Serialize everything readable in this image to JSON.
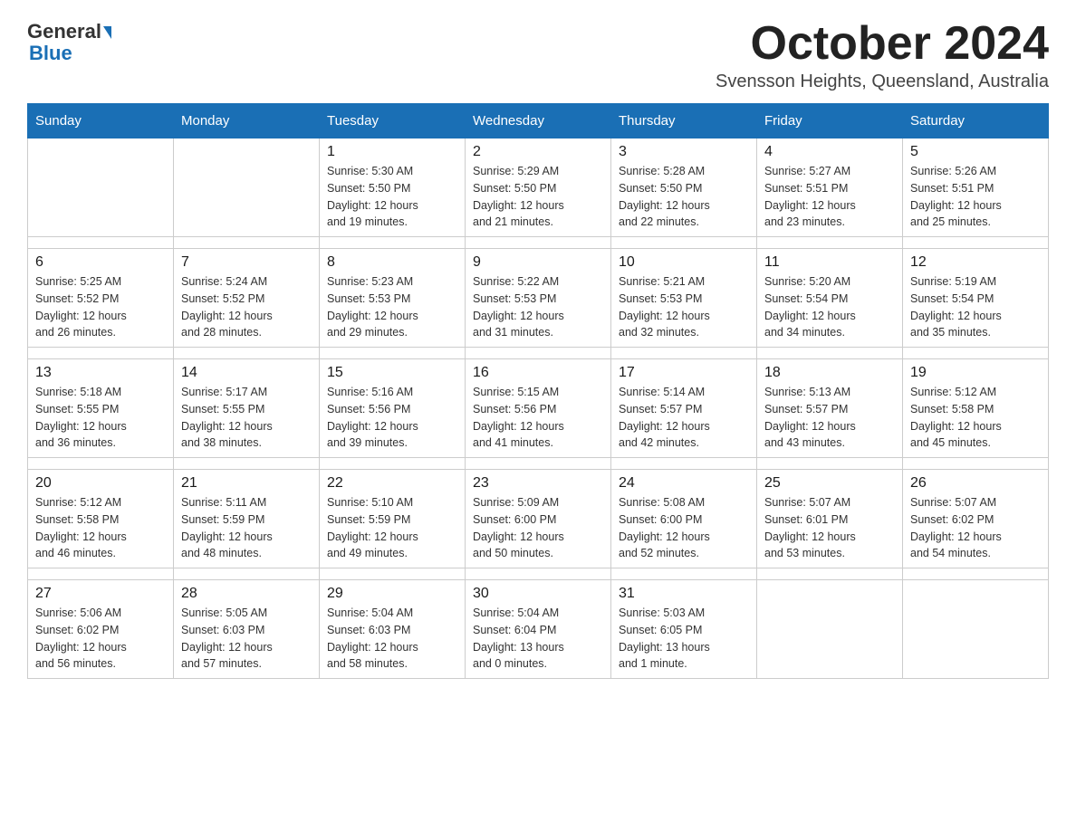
{
  "header": {
    "logo_general": "General",
    "logo_blue": "Blue",
    "month_title": "October 2024",
    "location": "Svensson Heights, Queensland, Australia"
  },
  "days_of_week": [
    "Sunday",
    "Monday",
    "Tuesday",
    "Wednesday",
    "Thursday",
    "Friday",
    "Saturday"
  ],
  "weeks": [
    [
      {
        "day": "",
        "info": ""
      },
      {
        "day": "",
        "info": ""
      },
      {
        "day": "1",
        "info": "Sunrise: 5:30 AM\nSunset: 5:50 PM\nDaylight: 12 hours\nand 19 minutes."
      },
      {
        "day": "2",
        "info": "Sunrise: 5:29 AM\nSunset: 5:50 PM\nDaylight: 12 hours\nand 21 minutes."
      },
      {
        "day": "3",
        "info": "Sunrise: 5:28 AM\nSunset: 5:50 PM\nDaylight: 12 hours\nand 22 minutes."
      },
      {
        "day": "4",
        "info": "Sunrise: 5:27 AM\nSunset: 5:51 PM\nDaylight: 12 hours\nand 23 minutes."
      },
      {
        "day": "5",
        "info": "Sunrise: 5:26 AM\nSunset: 5:51 PM\nDaylight: 12 hours\nand 25 minutes."
      }
    ],
    [
      {
        "day": "6",
        "info": "Sunrise: 5:25 AM\nSunset: 5:52 PM\nDaylight: 12 hours\nand 26 minutes."
      },
      {
        "day": "7",
        "info": "Sunrise: 5:24 AM\nSunset: 5:52 PM\nDaylight: 12 hours\nand 28 minutes."
      },
      {
        "day": "8",
        "info": "Sunrise: 5:23 AM\nSunset: 5:53 PM\nDaylight: 12 hours\nand 29 minutes."
      },
      {
        "day": "9",
        "info": "Sunrise: 5:22 AM\nSunset: 5:53 PM\nDaylight: 12 hours\nand 31 minutes."
      },
      {
        "day": "10",
        "info": "Sunrise: 5:21 AM\nSunset: 5:53 PM\nDaylight: 12 hours\nand 32 minutes."
      },
      {
        "day": "11",
        "info": "Sunrise: 5:20 AM\nSunset: 5:54 PM\nDaylight: 12 hours\nand 34 minutes."
      },
      {
        "day": "12",
        "info": "Sunrise: 5:19 AM\nSunset: 5:54 PM\nDaylight: 12 hours\nand 35 minutes."
      }
    ],
    [
      {
        "day": "13",
        "info": "Sunrise: 5:18 AM\nSunset: 5:55 PM\nDaylight: 12 hours\nand 36 minutes."
      },
      {
        "day": "14",
        "info": "Sunrise: 5:17 AM\nSunset: 5:55 PM\nDaylight: 12 hours\nand 38 minutes."
      },
      {
        "day": "15",
        "info": "Sunrise: 5:16 AM\nSunset: 5:56 PM\nDaylight: 12 hours\nand 39 minutes."
      },
      {
        "day": "16",
        "info": "Sunrise: 5:15 AM\nSunset: 5:56 PM\nDaylight: 12 hours\nand 41 minutes."
      },
      {
        "day": "17",
        "info": "Sunrise: 5:14 AM\nSunset: 5:57 PM\nDaylight: 12 hours\nand 42 minutes."
      },
      {
        "day": "18",
        "info": "Sunrise: 5:13 AM\nSunset: 5:57 PM\nDaylight: 12 hours\nand 43 minutes."
      },
      {
        "day": "19",
        "info": "Sunrise: 5:12 AM\nSunset: 5:58 PM\nDaylight: 12 hours\nand 45 minutes."
      }
    ],
    [
      {
        "day": "20",
        "info": "Sunrise: 5:12 AM\nSunset: 5:58 PM\nDaylight: 12 hours\nand 46 minutes."
      },
      {
        "day": "21",
        "info": "Sunrise: 5:11 AM\nSunset: 5:59 PM\nDaylight: 12 hours\nand 48 minutes."
      },
      {
        "day": "22",
        "info": "Sunrise: 5:10 AM\nSunset: 5:59 PM\nDaylight: 12 hours\nand 49 minutes."
      },
      {
        "day": "23",
        "info": "Sunrise: 5:09 AM\nSunset: 6:00 PM\nDaylight: 12 hours\nand 50 minutes."
      },
      {
        "day": "24",
        "info": "Sunrise: 5:08 AM\nSunset: 6:00 PM\nDaylight: 12 hours\nand 52 minutes."
      },
      {
        "day": "25",
        "info": "Sunrise: 5:07 AM\nSunset: 6:01 PM\nDaylight: 12 hours\nand 53 minutes."
      },
      {
        "day": "26",
        "info": "Sunrise: 5:07 AM\nSunset: 6:02 PM\nDaylight: 12 hours\nand 54 minutes."
      }
    ],
    [
      {
        "day": "27",
        "info": "Sunrise: 5:06 AM\nSunset: 6:02 PM\nDaylight: 12 hours\nand 56 minutes."
      },
      {
        "day": "28",
        "info": "Sunrise: 5:05 AM\nSunset: 6:03 PM\nDaylight: 12 hours\nand 57 minutes."
      },
      {
        "day": "29",
        "info": "Sunrise: 5:04 AM\nSunset: 6:03 PM\nDaylight: 12 hours\nand 58 minutes."
      },
      {
        "day": "30",
        "info": "Sunrise: 5:04 AM\nSunset: 6:04 PM\nDaylight: 13 hours\nand 0 minutes."
      },
      {
        "day": "31",
        "info": "Sunrise: 5:03 AM\nSunset: 6:05 PM\nDaylight: 13 hours\nand 1 minute."
      },
      {
        "day": "",
        "info": ""
      },
      {
        "day": "",
        "info": ""
      }
    ]
  ]
}
